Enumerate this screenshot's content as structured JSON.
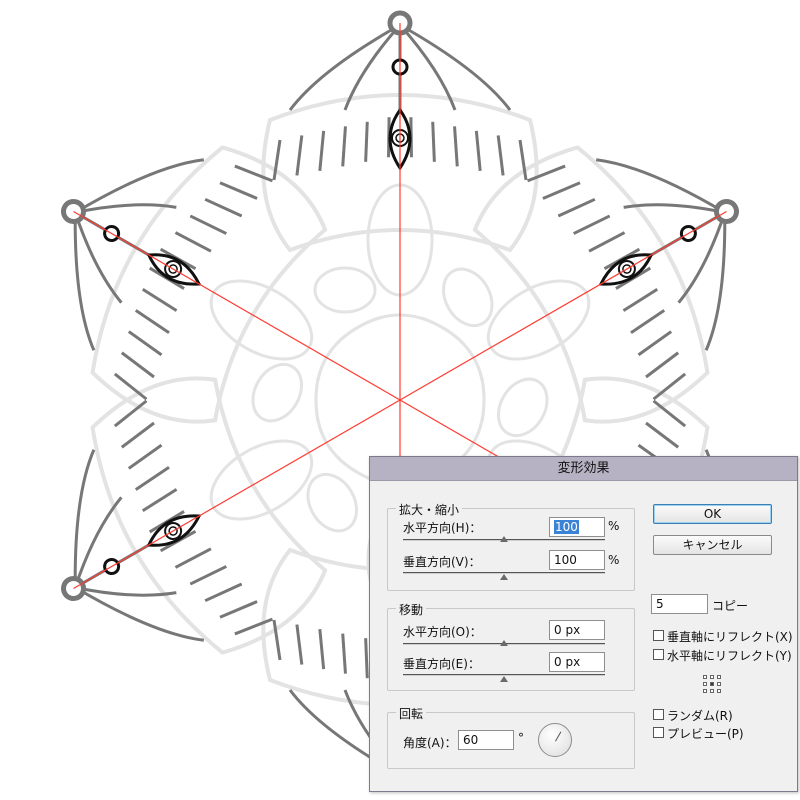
{
  "dialog": {
    "title": "変形効果",
    "scale": {
      "legend": "拡大・縮小",
      "horizontal": {
        "label": "水平方向(H)：",
        "value": "100",
        "unit": "%"
      },
      "vertical": {
        "label": "垂直方向(V)：",
        "value": "100",
        "unit": "%"
      }
    },
    "move": {
      "legend": "移動",
      "horizontal": {
        "label": "水平方向(O)：",
        "value": "0 px"
      },
      "vertical": {
        "label": "垂直方向(E)：",
        "value": "0 px"
      }
    },
    "rotate": {
      "legend": "回転",
      "angle_label": "角度(A)：",
      "angle_value": "60",
      "degree_symbol": "°"
    },
    "ok_label": "OK",
    "cancel_label": "キャンセル",
    "copies_value": "5",
    "copies_label": "コピー",
    "reflect_vertical_label": "垂直軸にリフレクト(X)",
    "reflect_horizontal_label": "水平軸にリフレクト(Y)",
    "random_label": "ランダム(R)",
    "preview_label": "プレビュー(P)",
    "reflect_vertical_checked": false,
    "reflect_horizontal_checked": false,
    "random_checked": false,
    "preview_checked": false
  },
  "colors": {
    "guide_line": "#ff3b30",
    "stroke_dark": "#777777",
    "stroke_light": "#e3e3e3",
    "title_bar": "#b7b2c3"
  }
}
